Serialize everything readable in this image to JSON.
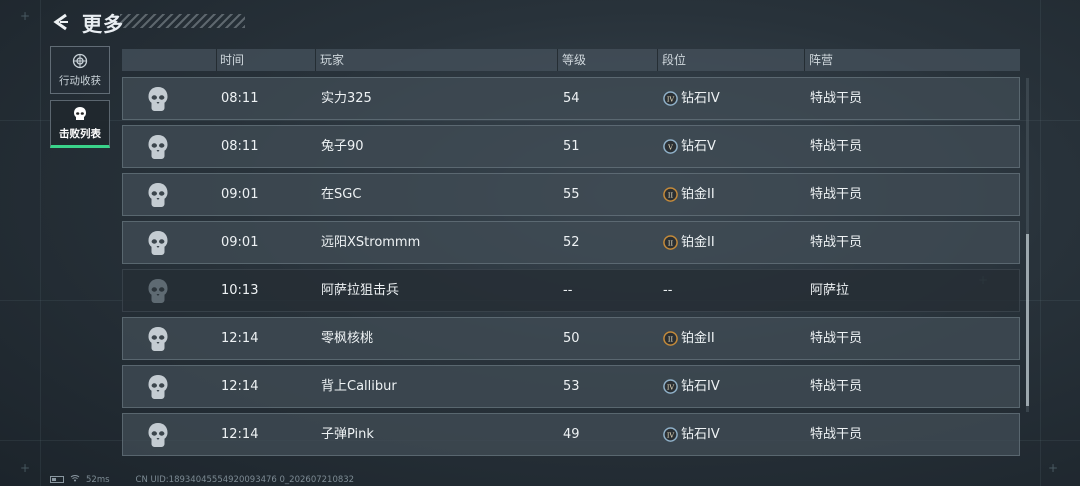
{
  "header": {
    "title": "更多",
    "back_icon": "back-arrow-icon"
  },
  "sidebar": {
    "tabs": [
      {
        "label": "行动收获",
        "icon": "loot-icon",
        "active": false
      },
      {
        "label": "击败列表",
        "icon": "skull-icon",
        "active": true
      }
    ]
  },
  "table": {
    "headers": {
      "time": "时间",
      "player": "玩家",
      "level": "等级",
      "rank": "段位",
      "faction": "阵营"
    },
    "rows": [
      {
        "time": "08:11",
        "player": "实力325",
        "level": "54",
        "rank": "钻石IV",
        "rank_icon": "IV",
        "faction": "特战干员",
        "npc": false
      },
      {
        "time": "08:11",
        "player": "兔子90",
        "level": "51",
        "rank": "钻石V",
        "rank_icon": "V",
        "faction": "特战干员",
        "npc": false
      },
      {
        "time": "09:01",
        "player": "在SGC",
        "level": "55",
        "rank": "铂金II",
        "rank_icon": "II",
        "faction": "特战干员",
        "npc": false
      },
      {
        "time": "09:01",
        "player": "远阳XStrommm",
        "level": "52",
        "rank": "铂金II",
        "rank_icon": "II",
        "faction": "特战干员",
        "npc": false
      },
      {
        "time": "10:13",
        "player": "阿萨拉狙击兵",
        "level": "--",
        "rank": "--",
        "rank_icon": "",
        "faction": "阿萨拉",
        "npc": true
      },
      {
        "time": "12:14",
        "player": "零枫核桃",
        "level": "50",
        "rank": "铂金II",
        "rank_icon": "II",
        "faction": "特战干员",
        "npc": false
      },
      {
        "time": "12:14",
        "player": "背上Callibur",
        "level": "53",
        "rank": "钻石IV",
        "rank_icon": "IV",
        "faction": "特战干员",
        "npc": false
      },
      {
        "time": "12:14",
        "player": "子弹Pink",
        "level": "49",
        "rank": "钻石IV",
        "rank_icon": "IV",
        "faction": "特战干员",
        "npc": false
      }
    ]
  },
  "footer": {
    "ping": "52ms",
    "uid": "CN UID:18934045554920093476 0_202607210832"
  },
  "colors": {
    "accent": "#3ad38a",
    "diamond": "#8fb0c8",
    "platinum": "#c48a3a"
  }
}
